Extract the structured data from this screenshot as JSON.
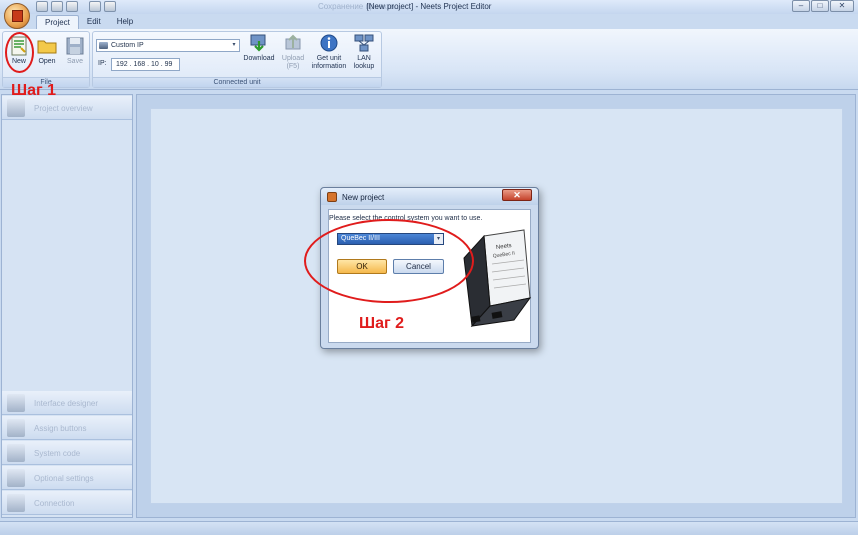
{
  "window": {
    "title": "[New project] - Neets Project Editor",
    "blurred_caption": "Сохранение проекта...",
    "buttons": {
      "minimize": "–",
      "maximize": "□",
      "close": "✕"
    }
  },
  "tabs": [
    "Project",
    "Edit",
    "Help"
  ],
  "ribbon": {
    "file_group": {
      "label": "File",
      "new": "New",
      "open": "Open",
      "save": "Save"
    },
    "connected_group": {
      "label": "Connected unit",
      "connection_type": "Custom IP",
      "ip_label": "IP:",
      "ip_value": "192 . 168 . 10 . 99",
      "download": "Download",
      "upload_line1": "Upload",
      "upload_line2": "(F5)",
      "get_info_line1": "Get unit",
      "get_info_line2": "information",
      "lan_line1": "LAN",
      "lan_line2": "lookup"
    }
  },
  "sidebar": {
    "top_item": "Project overview",
    "bottom_items": [
      "Interface designer",
      "Assign buttons",
      "System code",
      "Optional settings",
      "Connection"
    ]
  },
  "dialog": {
    "title": "New project",
    "close": "✕",
    "prompt": "Please select the control system you want to use.",
    "selected_system": "QueBec II/III",
    "ok": "OK",
    "cancel": "Cancel",
    "device_brand": "Neets",
    "device_model": "QueBec II"
  },
  "annotations": {
    "step1": "Шаг 1",
    "step2": "Шаг 2"
  },
  "colors": {
    "annotation": "#e01c1c",
    "ok_button": "#f5b84b",
    "selection": "#2b5fb0"
  }
}
